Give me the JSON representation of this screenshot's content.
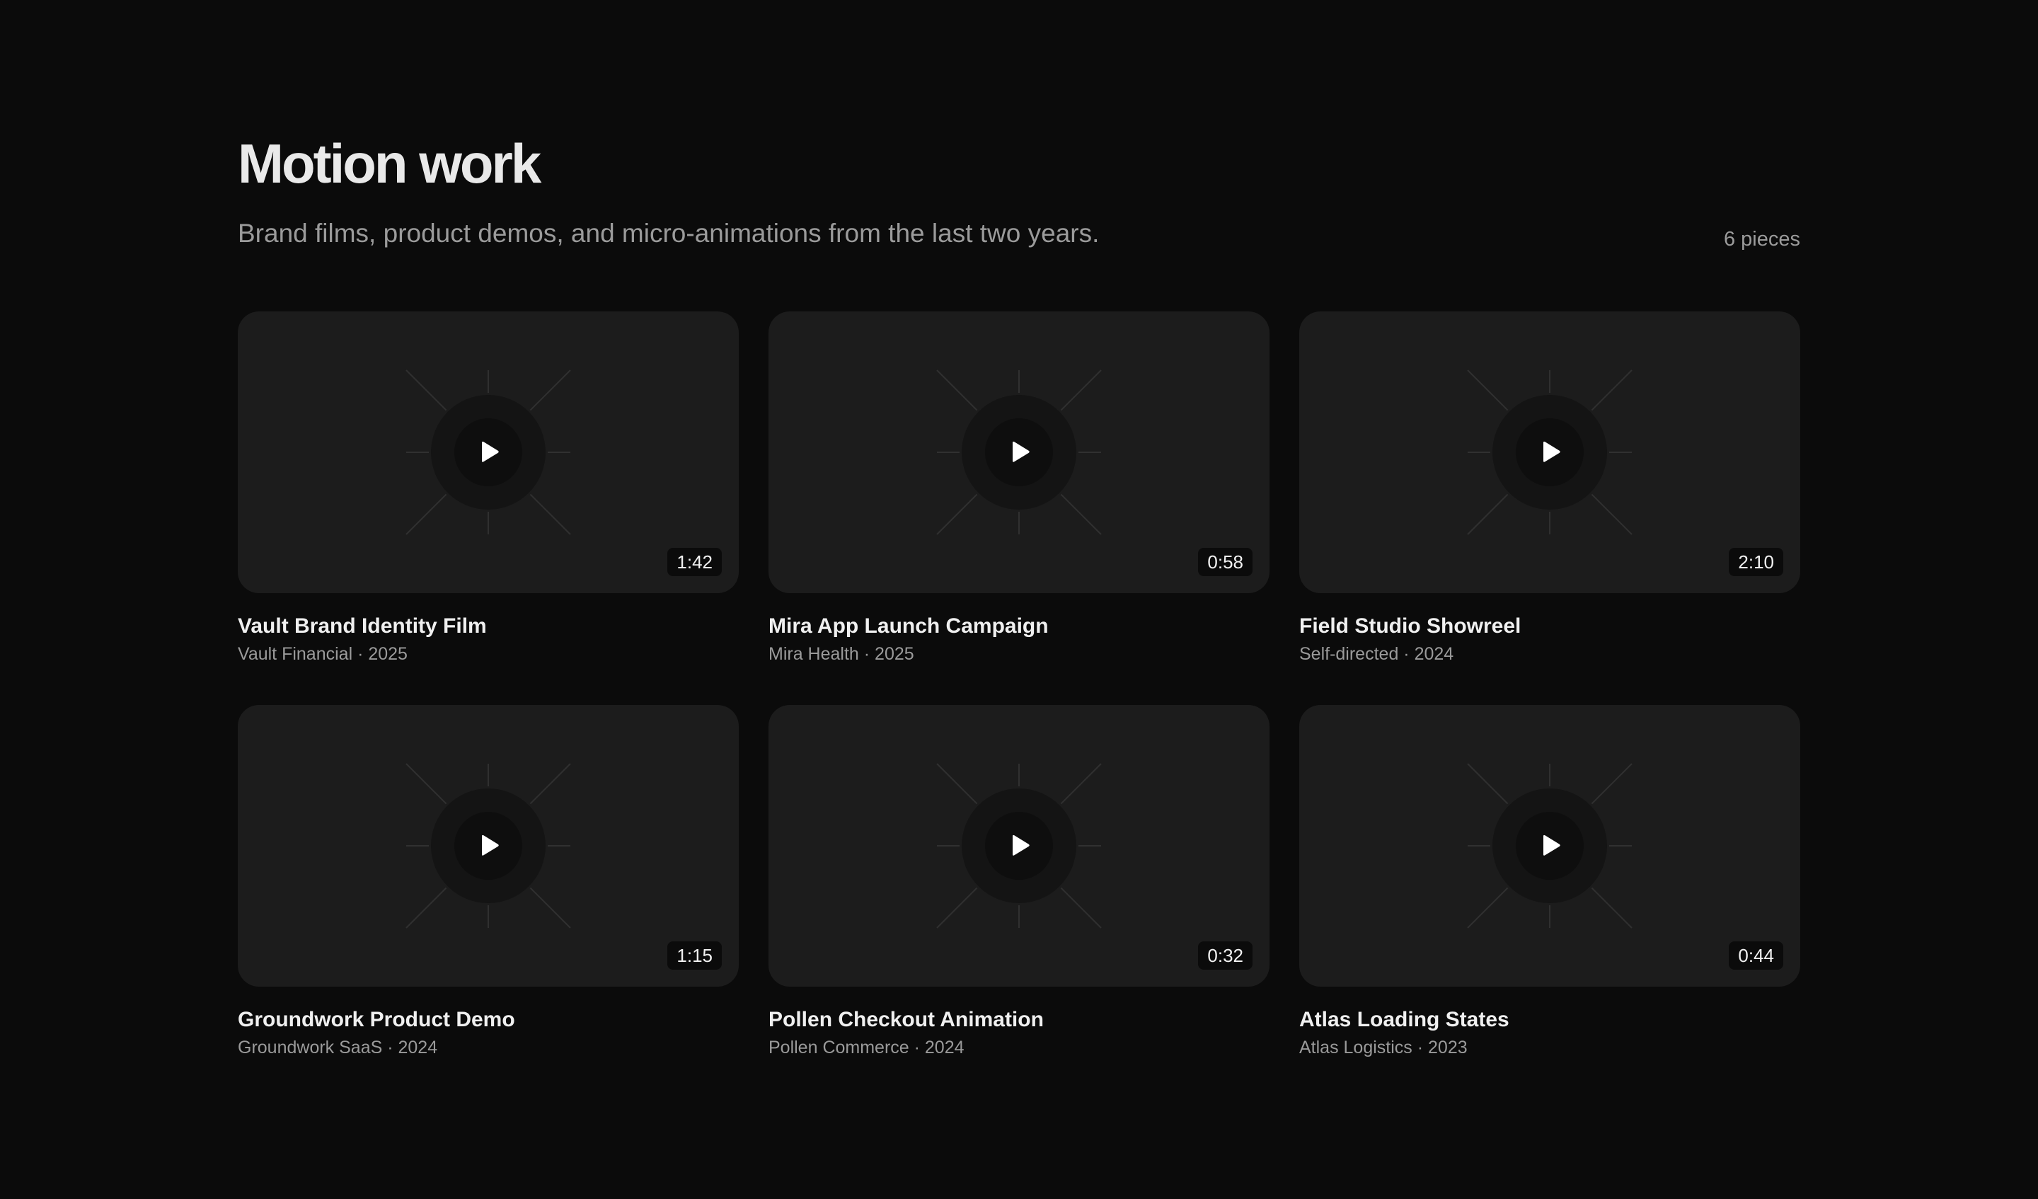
{
  "header": {
    "title": "Motion work",
    "subtitle": "Brand films, product demos, and micro-animations from the last two years.",
    "count_label": "6 pieces"
  },
  "projects": [
    {
      "title": "Vault Brand Identity Film",
      "client": "Vault Financial",
      "year": "2025",
      "duration": "1:42",
      "icon": "play-icon"
    },
    {
      "title": "Mira App Launch Campaign",
      "client": "Mira Health",
      "year": "2025",
      "duration": "0:58",
      "icon": "play-icon"
    },
    {
      "title": "Field Studio Showreel",
      "client": "Self-directed",
      "year": "2024",
      "duration": "2:10",
      "icon": "play-icon"
    },
    {
      "title": "Groundwork Product Demo",
      "client": "Groundwork SaaS",
      "year": "2024",
      "duration": "1:15",
      "icon": "play-icon"
    },
    {
      "title": "Pollen Checkout Animation",
      "client": "Pollen Commerce",
      "year": "2024",
      "duration": "0:32",
      "icon": "play-icon"
    },
    {
      "title": "Atlas Loading States",
      "client": "Atlas Logistics",
      "year": "2023",
      "duration": "0:44",
      "icon": "play-icon"
    }
  ],
  "colors": {
    "background": "#0b0b0b",
    "card": "#1c1c1c",
    "text": "#ececec",
    "muted": "#9b9b9b"
  }
}
